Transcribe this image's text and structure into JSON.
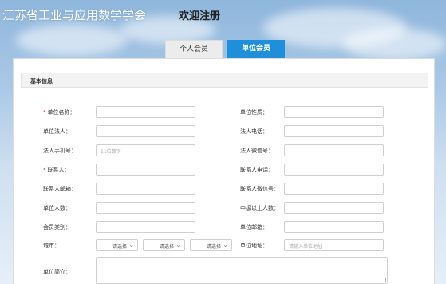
{
  "header": {
    "site_title": "江苏省工业与应用数学学会",
    "page_subtitle": "欢迎注册"
  },
  "tabs": [
    {
      "label": "个人会员",
      "active": false
    },
    {
      "label": "单位会员",
      "active": true
    }
  ],
  "section": {
    "title": "基本信息"
  },
  "form": {
    "left": [
      {
        "label": "单位名称：",
        "required": true,
        "placeholder": ""
      },
      {
        "label": "单位法人：",
        "required": false,
        "placeholder": ""
      },
      {
        "label": "法人手机号：",
        "required": false,
        "placeholder": "11位数字"
      },
      {
        "label": "联系人：",
        "required": true,
        "placeholder": ""
      },
      {
        "label": "联系人邮箱：",
        "required": false,
        "placeholder": ""
      },
      {
        "label": "单位人数：",
        "required": false,
        "placeholder": ""
      },
      {
        "label": "会员类别：",
        "required": false,
        "placeholder": ""
      }
    ],
    "right": [
      {
        "label": "单位性质：",
        "placeholder": ""
      },
      {
        "label": "法人电话：",
        "placeholder": ""
      },
      {
        "label": "法人微信号：",
        "placeholder": ""
      },
      {
        "label": "联系人电话：",
        "placeholder": ""
      },
      {
        "label": "联系人微信号：",
        "placeholder": ""
      },
      {
        "label": "中级以上人数：",
        "placeholder": ""
      },
      {
        "label": "单位邮箱：",
        "placeholder": ""
      }
    ],
    "city": {
      "label": "城市：",
      "selects": [
        "请选择",
        "请选择",
        "请选择"
      ]
    },
    "address": {
      "label": "单位地址：",
      "placeholder": "请输入单位地址"
    },
    "intro": {
      "label": "单位简介："
    }
  },
  "colors": {
    "accent": "#1e8fd8",
    "required": "#e02020"
  }
}
